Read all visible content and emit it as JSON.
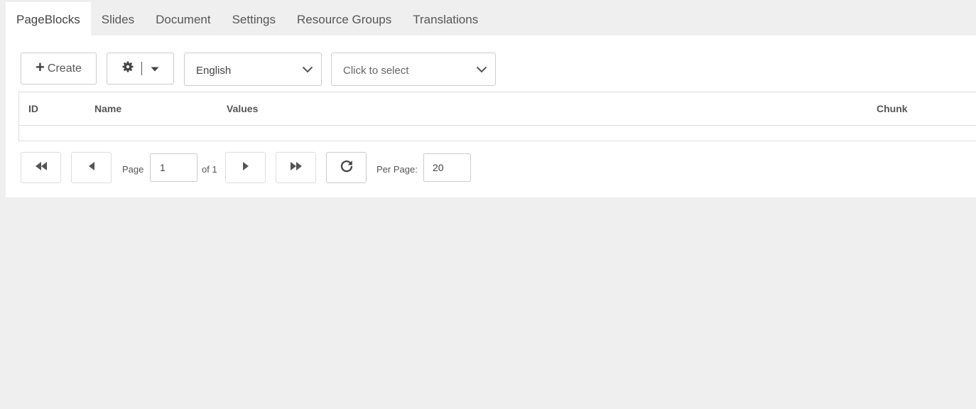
{
  "tabs": [
    {
      "label": "PageBlocks",
      "active": true
    },
    {
      "label": "Slides"
    },
    {
      "label": "Document"
    },
    {
      "label": "Settings"
    },
    {
      "label": "Resource Groups"
    },
    {
      "label": "Translations"
    }
  ],
  "toolbar": {
    "create_label": "Create",
    "language_value": "English",
    "filter_placeholder": "Click to select"
  },
  "grid": {
    "columns": [
      "ID",
      "Name",
      "Values",
      "Chunk"
    ],
    "rows": []
  },
  "pager": {
    "page_label": "Page",
    "page_value": "1",
    "of_label": "of 1",
    "per_page_label": "Per Page:",
    "per_page_value": "20"
  },
  "icons": {
    "create": "plus-icon",
    "settings": "gear-icon",
    "settings_menu": "caret-down-icon",
    "select_arrow": "chevron-down-icon",
    "first": "double-left-icon",
    "prev": "left-icon",
    "next": "right-icon",
    "last": "double-right-icon",
    "refresh": "refresh-icon"
  }
}
